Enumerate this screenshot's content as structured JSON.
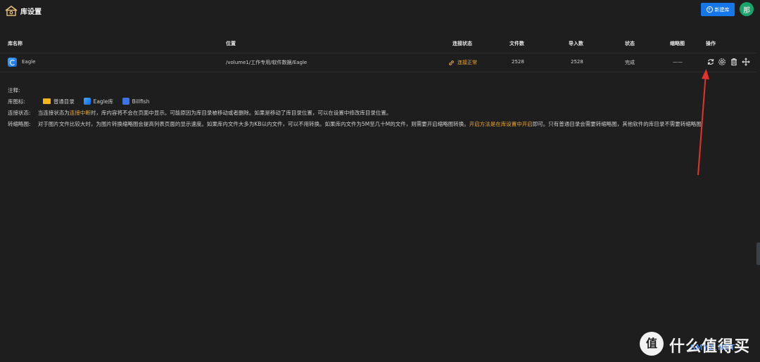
{
  "header": {
    "title": "库设置",
    "new_button": "新建库",
    "avatar_text": "那"
  },
  "columns": {
    "name": "库名称",
    "location": "位置",
    "link_status": "连接状态",
    "file_count": "文件数",
    "import_count": "导入数",
    "status": "状态",
    "thumbnail": "缩略图",
    "actions": "操作"
  },
  "rows": [
    {
      "name": "Eagle",
      "location": "/volume1/工作专用/软件数据/Eagle",
      "link_status": "连接正常",
      "file_count": "2528",
      "import_count": "2528",
      "status": "完成",
      "thumbnail": "——"
    }
  ],
  "notes": {
    "title": "注释:",
    "icon_label": "库图标:",
    "icon_items": [
      "普通目录",
      "Eagle库",
      "Billfish"
    ],
    "link_label": "连接状态:",
    "link_text_1": "当连接状态为",
    "link_highlight": "连接中断",
    "link_text_2": "时，库内容将不会在页面中显示。可能原因为库目录被移动或者删除。如果是移动了库目录位置，可以在设置中修改库目录位置。",
    "thumb_label": "转缩略图:",
    "thumb_text_1": "对于图片文件比较大时，为图片转换缩略图会提高列表页面的显示速度。如果库内文件大多为KB以内文件，可以不用转换。如果库内文件为5M至几十M的文件，则需要开启缩略图转换。",
    "thumb_highlight": "开启方法是在库设置中开启",
    "thumb_text_2": "即可。只有普通目录会需要转缩略图，其他软件的库目录不需要转缩略图"
  },
  "watermark": {
    "text": "什么值得买",
    "sub": "SMYZ.NET"
  },
  "colors": {
    "background": "#1e1e1e",
    "primary_button": "#1677e8",
    "avatar": "#1aa36a",
    "highlight": "#e8a93a",
    "arrow": "#e5322d"
  },
  "icons": {
    "home": "home-icon",
    "link": "link-icon",
    "refresh": "refresh-icon",
    "settings": "gear-icon",
    "delete": "trash-icon",
    "move": "move-icon"
  }
}
